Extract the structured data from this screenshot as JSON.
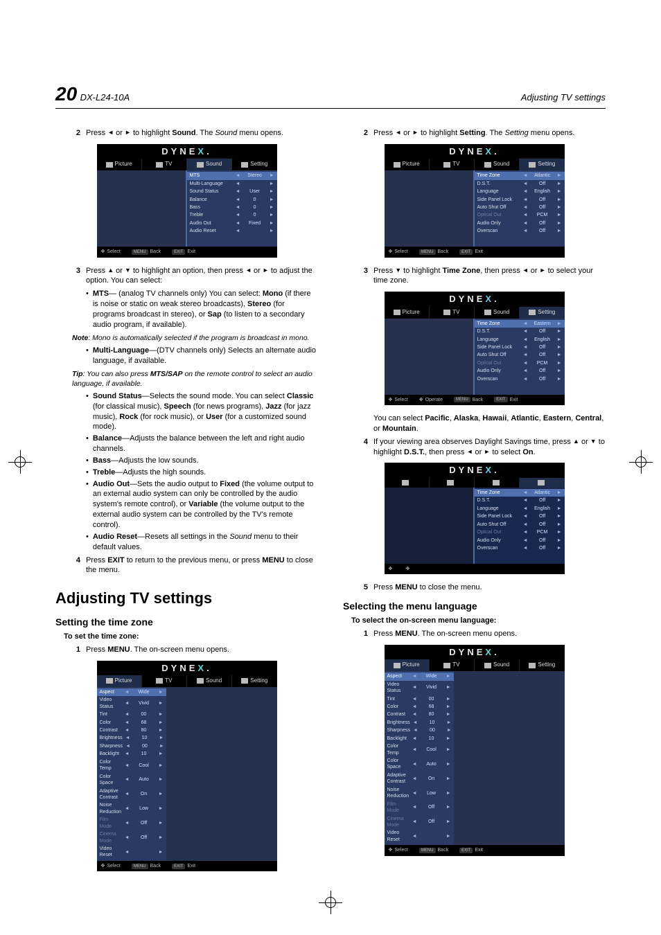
{
  "header": {
    "pagenum": "20",
    "model": "DX-L24-10A",
    "section": "Adjusting TV settings"
  },
  "arrows": {
    "left": "◄",
    "right": "►",
    "up": "▲",
    "down": "▼"
  },
  "left": {
    "step2": {
      "pre": "Press ",
      "mid": " or ",
      "post": " to highlight ",
      "hl": "Sound",
      "tail1": ". The ",
      "it": "Sound",
      "tail2": " menu opens."
    },
    "step3": {
      "pre": "Press ",
      "mid": " or ",
      "post": " to highlight an option, then press ",
      "mid2": " or ",
      "tail": " to adjust the option. You can select:"
    },
    "mts_label": "MTS",
    "mts_body1": "— (analog TV channels only) You can select: ",
    "mts_mono": "Mono",
    "mts_body2": " (if there is noise or static on weak stereo broadcasts), ",
    "mts_stereo": "Stereo",
    "mts_body3": " (for programs broadcast in stereo), or ",
    "mts_sap": "Sap",
    "mts_body4": " (to listen to a secondary audio program, if available).",
    "note1_label": "Note",
    "note1_body": ": Mono is automatically selected if the program is broadcast in mono.",
    "ml_label": "Multi-Language",
    "ml_body": "—(DTV channels only) Selects an alternate audio language, if available.",
    "tip_label": "Tip",
    "tip_body1": ": You can also press ",
    "tip_key": "MTS/SAP",
    "tip_body2": " on the remote control to select an audio language, if available.",
    "ss_label": "Sound Status",
    "ss_body1": "—Selects the sound mode. You can select ",
    "ss_classic": "Classic",
    "ss_b2": " (for classical music), ",
    "ss_speech": "Speech",
    "ss_b3": " (for news programs), ",
    "ss_jazz": "Jazz",
    "ss_b4": " (for jazz music), ",
    "ss_rock": "Rock",
    "ss_b5": " (for rock music), or ",
    "ss_user": "User",
    "ss_b6": " (for a customized sound mode).",
    "bal_label": "Balance",
    "bal_body": "—Adjusts the balance between the left and right audio channels.",
    "bass_label": "Bass",
    "bass_body": "—Adjusts the low sounds.",
    "treble_label": "Treble",
    "treble_body": "—Adjusts the high sounds.",
    "ao_label": "Audio Out",
    "ao_b1": "—Sets the audio output to ",
    "ao_fixed": "Fixed",
    "ao_b2": " (the volume output to an external audio system can only be controlled by the audio system's remote control), or ",
    "ao_var": "Variable",
    "ao_b3": " (the volume output to the external audio system can be controlled by the TV's remote control).",
    "ar_label": "Audio Reset",
    "ar_b1": "—Resets all settings in the ",
    "ar_it": "Sound",
    "ar_b2": " menu to their default values.",
    "step4": {
      "pre": "Press ",
      "key": "EXIT",
      "mid": " to return to the previous menu, or press ",
      "key2": "MENU",
      "tail": " to close the menu."
    },
    "h1": "Adjusting TV settings",
    "h2": "Setting the time zone",
    "proc": "To set the time zone:",
    "s1": {
      "pre": "Press ",
      "key": "MENU",
      "tail": ". The on-screen menu opens."
    }
  },
  "right": {
    "step2": {
      "pre": "Press ",
      "mid": " or ",
      "post": " to highlight ",
      "hl": "Setting",
      "tail1": ". The ",
      "it": "Setting",
      "tail2": " menu opens."
    },
    "step3": {
      "pre": "Press ",
      "mid": " to highlight ",
      "hl": "Time Zone",
      "post": ", then press ",
      "mid2": " or ",
      "tail": " to select your time zone."
    },
    "tz_body1": "You can select ",
    "tz_pacific": "Pacific",
    "c1": ", ",
    "tz_alaska": "Alaska",
    "c2": ", ",
    "tz_hawaii": "Hawaii",
    "c3": ", ",
    "tz_atlantic": "Atlantic",
    "c4": ", ",
    "tz_eastern": "Eastern",
    "c5": ", ",
    "tz_central": "Central",
    "c6": ", or ",
    "tz_mountain": "Mountain",
    "tz_period": ".",
    "step4": {
      "pre": "If your viewing area observes Daylight Savings time, press ",
      "mid": " or ",
      "post": " to highlight ",
      "hl": "D.S.T.",
      "post2": ", then press ",
      "mid2": " or ",
      "tail": " to select ",
      "on": "On",
      "period": "."
    },
    "step5": {
      "pre": "Press ",
      "key": "MENU",
      "tail": " to close the menu."
    },
    "h2": "Selecting the menu language",
    "proc": "To select the on-screen menu language:",
    "s1": {
      "pre": "Press ",
      "key": "MENU",
      "tail": ". The on-screen menu opens."
    }
  },
  "osd": {
    "logo1": "DYNE",
    "logoX": "X",
    "logoDot": ".",
    "tabs": {
      "picture": "Picture",
      "tv": "TV",
      "sound": "Sound",
      "setting": "Setting"
    },
    "hints": {
      "select": "Select",
      "back": "Back",
      "exit": "Exit",
      "operate": "Operate",
      "menu": "MENU",
      "exitkey": "EXIT"
    },
    "sound_rows": [
      {
        "l": "MTS",
        "v": "Stereo",
        "hi": true
      },
      {
        "l": "Multi-Language",
        "v": ""
      },
      {
        "l": "Sound Status",
        "v": "User"
      },
      {
        "l": "Balance",
        "v": "0"
      },
      {
        "l": "Bass",
        "v": "0"
      },
      {
        "l": "Treble",
        "v": "0"
      },
      {
        "l": "Audio Out",
        "v": "Fixed"
      },
      {
        "l": "Audio Reset",
        "v": ""
      }
    ],
    "setting_rows_a": [
      {
        "l": "Time Zone",
        "v": "Atlantic",
        "hi": true
      },
      {
        "l": "D.S.T.",
        "v": "Off"
      },
      {
        "l": "Language",
        "v": "English"
      },
      {
        "l": "Side Panel Lock",
        "v": "Off"
      },
      {
        "l": "Auto Shut Off",
        "v": "Off"
      },
      {
        "l": "Optical Out",
        "v": "PCM",
        "dim": true
      },
      {
        "l": "Audio Only",
        "v": "Off"
      },
      {
        "l": "Overscan",
        "v": "Off"
      }
    ],
    "setting_rows_b": [
      {
        "l": "Time Zone",
        "v": "Eastern",
        "hi": true
      },
      {
        "l": "D.S.T.",
        "v": "Off"
      },
      {
        "l": "Language",
        "v": "English"
      },
      {
        "l": "Side Panel Lock",
        "v": "Off"
      },
      {
        "l": "Auto Shut Off",
        "v": "Off"
      },
      {
        "l": "Optical Out",
        "v": "PCM",
        "dim": true
      },
      {
        "l": "Audio Only",
        "v": "Off"
      },
      {
        "l": "Overscan",
        "v": "Off"
      }
    ],
    "picture_rows": [
      {
        "l": "Aspect",
        "v": "Wide",
        "hi": true
      },
      {
        "l": "Video Status",
        "v": "Vivid"
      },
      {
        "l": "Tint",
        "v": "00"
      },
      {
        "l": "Color",
        "v": "68"
      },
      {
        "l": "Contrast",
        "v": "80"
      },
      {
        "l": "Brightness",
        "v": "10"
      },
      {
        "l": "Sharpness",
        "v": "00"
      },
      {
        "l": "Backlight",
        "v": "10"
      },
      {
        "l": "Color Temp",
        "v": "Cool"
      },
      {
        "l": "Color Space",
        "v": "Auto"
      },
      {
        "l": "Adaptive Contrast",
        "v": "On"
      },
      {
        "l": "Noise Reduction",
        "v": "Low"
      },
      {
        "l": "Film Mode",
        "v": "Off",
        "dim": true
      },
      {
        "l": "Cinema Mode",
        "v": "Off",
        "dim": true
      },
      {
        "l": "Video Reset",
        "v": ""
      }
    ]
  }
}
